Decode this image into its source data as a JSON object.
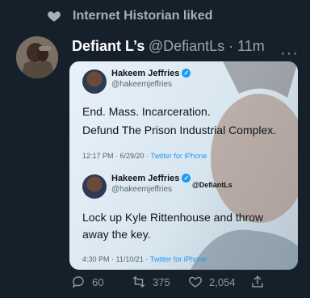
{
  "social_context": {
    "text": "Internet Historian liked"
  },
  "tweet": {
    "display_name": "Defiant L’s",
    "handle_time": "@DefiantLs · 11m",
    "more": "···"
  },
  "media": {
    "watermark": "@DefiantLs",
    "cards": [
      {
        "name": "Hakeem Jeffries",
        "handle": "@hakeemjeffries",
        "line1": "End. Mass. Incarceration.",
        "line2": "Defund The Prison Industrial Complex.",
        "meta": "12:17 PM · 6/29/20 · ",
        "source": "Twitter for iPhone"
      },
      {
        "name": "Hakeem Jeffries",
        "handle": "@hakeemjeffries",
        "line1": "Lock up Kyle Rittenhouse and throw",
        "line2": "away the key.",
        "meta": "4:30 PM · 11/10/21 · ",
        "source": "Twitter for iPhone"
      }
    ]
  },
  "actions": {
    "replies": "60",
    "retweets": "375",
    "likes": "2,054"
  },
  "icons": [
    "heart-icon",
    "reply-icon",
    "retweet-icon",
    "like-icon",
    "share-icon",
    "verified-icon",
    "more-icon"
  ],
  "colors": {
    "background": "#15202b",
    "accent": "#1d9bf0"
  }
}
